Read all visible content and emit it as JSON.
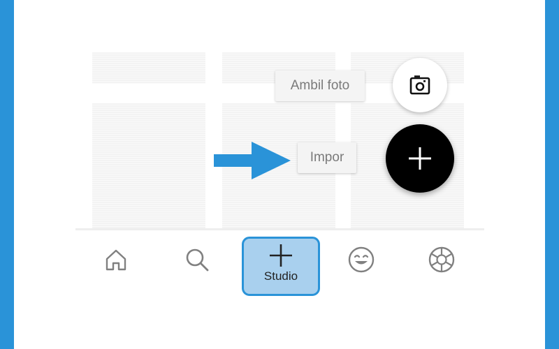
{
  "speed_dial": {
    "take_photo_label": "Ambil foto",
    "import_label": "Impor",
    "camera_icon": "camera-icon",
    "add_icon": "plus-icon"
  },
  "bottom_nav": {
    "items": [
      {
        "icon": "home-icon"
      },
      {
        "icon": "search-icon"
      },
      {
        "icon": "plus-icon",
        "label": "Studio",
        "selected": true
      },
      {
        "icon": "smile-icon"
      },
      {
        "icon": "aperture-icon"
      }
    ]
  },
  "colors": {
    "frame": "#2A93D8",
    "highlight_fill": "#A9D0EE",
    "fab": "#000000",
    "icon_gray": "#808080"
  }
}
